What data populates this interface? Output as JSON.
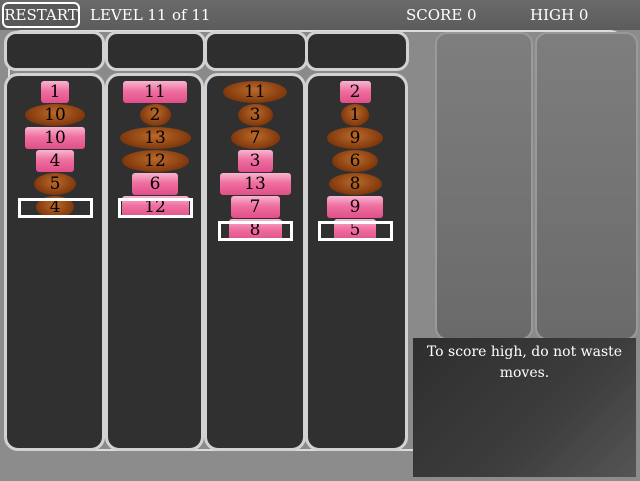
{
  "header": {
    "restart_label": "RESTART",
    "level_label": "LEVEL 11",
    "of_label": "of 11",
    "score_label": "SCORE 0",
    "high_label": "HIGH 0"
  },
  "message": "To score high, do not waste moves.",
  "colors": {
    "pink": "#ef6fa0",
    "brown": "#8a3f10",
    "background": "#8c8c8c",
    "tube": "#303030"
  },
  "columns": [
    {
      "pieces": [
        {
          "n": "1",
          "c": "pink"
        },
        {
          "n": "10",
          "c": "brown"
        },
        {
          "n": "10",
          "c": "pink"
        },
        {
          "n": "4",
          "c": "pink"
        },
        {
          "n": "5",
          "c": "brown"
        },
        {
          "n": "4",
          "c": "brown"
        }
      ]
    },
    {
      "pieces": [
        {
          "n": "11",
          "c": "pink"
        },
        {
          "n": "2",
          "c": "brown"
        },
        {
          "n": "13",
          "c": "brown"
        },
        {
          "n": "12",
          "c": "brown"
        },
        {
          "n": "6",
          "c": "pink"
        },
        {
          "n": "12",
          "c": "pink"
        }
      ]
    },
    {
      "pieces": [
        {
          "n": "11",
          "c": "brown"
        },
        {
          "n": "3",
          "c": "brown"
        },
        {
          "n": "7",
          "c": "brown"
        },
        {
          "n": "3",
          "c": "pink"
        },
        {
          "n": "13",
          "c": "pink"
        },
        {
          "n": "7",
          "c": "pink"
        },
        {
          "n": "8",
          "c": "pink"
        }
      ]
    },
    {
      "pieces": [
        {
          "n": "2",
          "c": "pink"
        },
        {
          "n": "1",
          "c": "brown"
        },
        {
          "n": "9",
          "c": "brown"
        },
        {
          "n": "6",
          "c": "brown"
        },
        {
          "n": "8",
          "c": "brown"
        },
        {
          "n": "9",
          "c": "pink"
        },
        {
          "n": "5",
          "c": "pink"
        }
      ]
    }
  ]
}
